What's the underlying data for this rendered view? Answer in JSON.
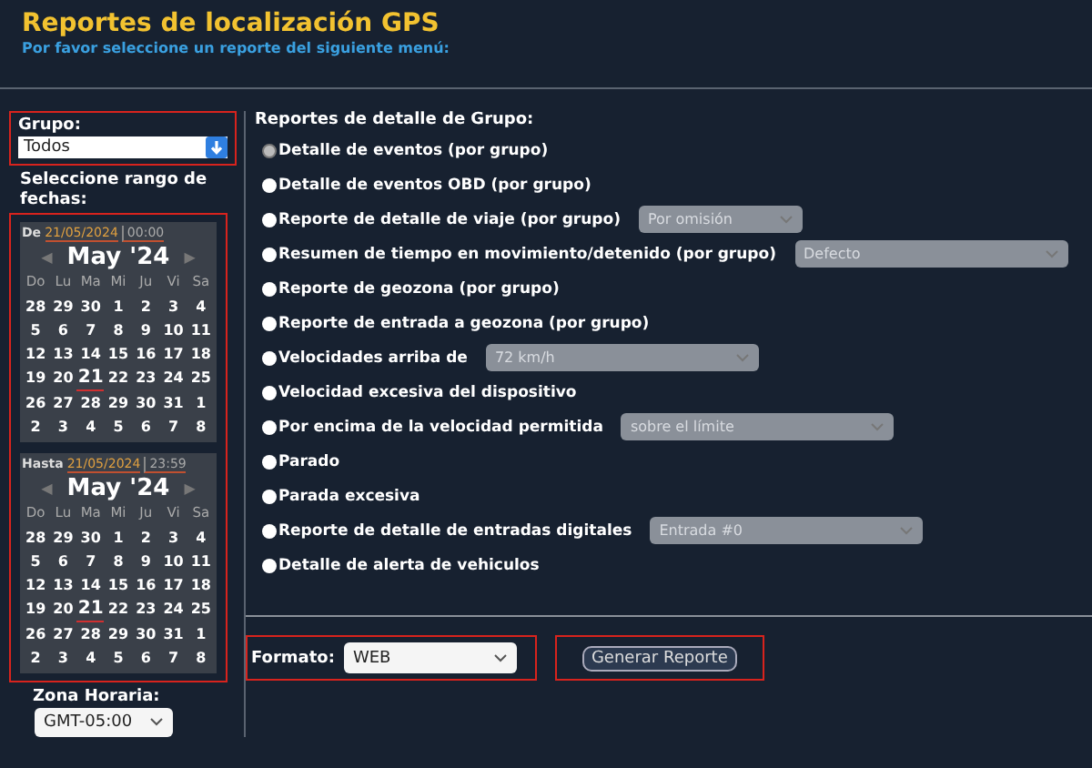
{
  "header": {
    "title": "Reportes de localización GPS",
    "subtitle": "Por favor seleccione un reporte del siguiente menú:"
  },
  "group": {
    "label": "Grupo:",
    "value": "Todos"
  },
  "range_label": "Seleccione rango de fechas:",
  "calendars": [
    {
      "label": "De",
      "date": "21/05/2024",
      "time": "00:00",
      "month": "May '24",
      "prev": "◀",
      "next": "▶",
      "weekdays": [
        "Do",
        "Lu",
        "Ma",
        "Mi",
        "Ju",
        "Vi",
        "Sa"
      ],
      "weeks": [
        [
          {
            "d": "28",
            "selected": false
          },
          {
            "d": "29",
            "selected": false
          },
          {
            "d": "30",
            "selected": false
          },
          {
            "d": "1",
            "selected": false
          },
          {
            "d": "2",
            "selected": false
          },
          {
            "d": "3",
            "selected": false
          },
          {
            "d": "4",
            "selected": false
          }
        ],
        [
          {
            "d": "5",
            "selected": false
          },
          {
            "d": "6",
            "selected": false
          },
          {
            "d": "7",
            "selected": false
          },
          {
            "d": "8",
            "selected": false
          },
          {
            "d": "9",
            "selected": false
          },
          {
            "d": "10",
            "selected": false
          },
          {
            "d": "11",
            "selected": false
          }
        ],
        [
          {
            "d": "12",
            "selected": false
          },
          {
            "d": "13",
            "selected": false
          },
          {
            "d": "14",
            "selected": false
          },
          {
            "d": "15",
            "selected": false
          },
          {
            "d": "16",
            "selected": false
          },
          {
            "d": "17",
            "selected": false
          },
          {
            "d": "18",
            "selected": false
          }
        ],
        [
          {
            "d": "19",
            "selected": false
          },
          {
            "d": "20",
            "selected": false
          },
          {
            "d": "21",
            "selected": true
          },
          {
            "d": "22",
            "selected": false
          },
          {
            "d": "23",
            "selected": false
          },
          {
            "d": "24",
            "selected": false
          },
          {
            "d": "25",
            "selected": false
          }
        ],
        [
          {
            "d": "26",
            "selected": false
          },
          {
            "d": "27",
            "selected": false
          },
          {
            "d": "28",
            "selected": false
          },
          {
            "d": "29",
            "selected": false
          },
          {
            "d": "30",
            "selected": false
          },
          {
            "d": "31",
            "selected": false
          },
          {
            "d": "1",
            "selected": false
          }
        ],
        [
          {
            "d": "2",
            "selected": false
          },
          {
            "d": "3",
            "selected": false
          },
          {
            "d": "4",
            "selected": false
          },
          {
            "d": "5",
            "selected": false
          },
          {
            "d": "6",
            "selected": false
          },
          {
            "d": "7",
            "selected": false
          },
          {
            "d": "8",
            "selected": false
          }
        ]
      ]
    },
    {
      "label": "Hasta",
      "date": "21/05/2024",
      "time": "23:59",
      "month": "May '24",
      "prev": "◀",
      "next": "▶",
      "weekdays": [
        "Do",
        "Lu",
        "Ma",
        "Mi",
        "Ju",
        "Vi",
        "Sa"
      ],
      "weeks": [
        [
          {
            "d": "28",
            "selected": false
          },
          {
            "d": "29",
            "selected": false
          },
          {
            "d": "30",
            "selected": false
          },
          {
            "d": "1",
            "selected": false
          },
          {
            "d": "2",
            "selected": false
          },
          {
            "d": "3",
            "selected": false
          },
          {
            "d": "4",
            "selected": false
          }
        ],
        [
          {
            "d": "5",
            "selected": false
          },
          {
            "d": "6",
            "selected": false
          },
          {
            "d": "7",
            "selected": false
          },
          {
            "d": "8",
            "selected": false
          },
          {
            "d": "9",
            "selected": false
          },
          {
            "d": "10",
            "selected": false
          },
          {
            "d": "11",
            "selected": false
          }
        ],
        [
          {
            "d": "12",
            "selected": false
          },
          {
            "d": "13",
            "selected": false
          },
          {
            "d": "14",
            "selected": false
          },
          {
            "d": "15",
            "selected": false
          },
          {
            "d": "16",
            "selected": false
          },
          {
            "d": "17",
            "selected": false
          },
          {
            "d": "18",
            "selected": false
          }
        ],
        [
          {
            "d": "19",
            "selected": false
          },
          {
            "d": "20",
            "selected": false
          },
          {
            "d": "21",
            "selected": true
          },
          {
            "d": "22",
            "selected": false
          },
          {
            "d": "23",
            "selected": false
          },
          {
            "d": "24",
            "selected": false
          },
          {
            "d": "25",
            "selected": false
          }
        ],
        [
          {
            "d": "26",
            "selected": false
          },
          {
            "d": "27",
            "selected": false
          },
          {
            "d": "28",
            "selected": false
          },
          {
            "d": "29",
            "selected": false
          },
          {
            "d": "30",
            "selected": false
          },
          {
            "d": "31",
            "selected": false
          },
          {
            "d": "1",
            "selected": false
          }
        ],
        [
          {
            "d": "2",
            "selected": false
          },
          {
            "d": "3",
            "selected": false
          },
          {
            "d": "4",
            "selected": false
          },
          {
            "d": "5",
            "selected": false
          },
          {
            "d": "6",
            "selected": false
          },
          {
            "d": "7",
            "selected": false
          },
          {
            "d": "8",
            "selected": false
          }
        ]
      ]
    }
  ],
  "timezone": {
    "label": "Zona Horaria:",
    "value": "GMT-05:00"
  },
  "reports": {
    "heading": "Reportes de detalle de Grupo:",
    "options": [
      {
        "label": "Detalle de eventos (por grupo)",
        "selected": true
      },
      {
        "label": "Detalle de eventos OBD (por grupo)",
        "selected": false
      },
      {
        "label": "Reporte de detalle de viaje (por grupo)",
        "selected": false,
        "select": {
          "value": "Por omisión",
          "disabled": true
        }
      },
      {
        "label": "Resumen de tiempo en movimiento/detenido (por grupo)",
        "selected": false,
        "select": {
          "value": "Defecto",
          "disabled": true
        }
      },
      {
        "label": "Reporte de geozona (por grupo)",
        "selected": false
      },
      {
        "label": "Reporte de entrada a geozona (por grupo)",
        "selected": false
      },
      {
        "label": "Velocidades arriba de",
        "selected": false,
        "select": {
          "value": "72 km/h",
          "disabled": true
        }
      },
      {
        "label": "Velocidad excesiva del dispositivo",
        "selected": false
      },
      {
        "label": "Por encima de la velocidad permitida",
        "selected": false,
        "select": {
          "value": "sobre el límite",
          "disabled": true
        }
      },
      {
        "label": "Parado",
        "selected": false
      },
      {
        "label": "Parada excesiva",
        "selected": false
      },
      {
        "label": "Reporte de detalle de entradas digitales",
        "selected": false,
        "select": {
          "value": "Entrada #0",
          "disabled": true
        }
      },
      {
        "label": "Detalle de alerta de vehiculos",
        "selected": false
      }
    ]
  },
  "format": {
    "label": "Formato:",
    "value": "WEB"
  },
  "generate_button": "Generar Reporte"
}
